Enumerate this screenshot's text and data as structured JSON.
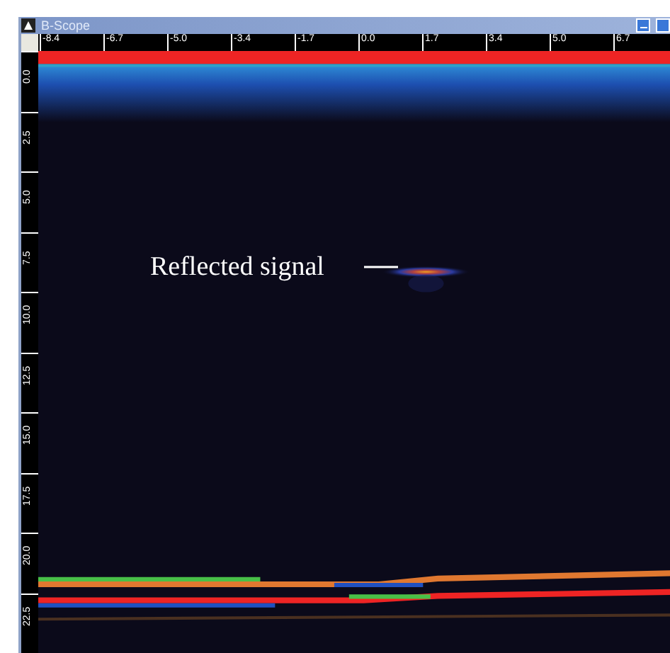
{
  "window": {
    "title": "B-Scope"
  },
  "x_ruler": [
    "-8.4",
    "-6.7",
    "-5.0",
    "-3.4",
    "-1.7",
    "0.0",
    "1.7",
    "3.4",
    "5.0",
    "6.7"
  ],
  "y_ruler": [
    "0.0",
    "2.5",
    "5.0",
    "7.5",
    "10.0",
    "12.5",
    "15.0",
    "17.5",
    "20.0",
    "22.5"
  ],
  "annotation": {
    "text": "Reflected signal"
  }
}
